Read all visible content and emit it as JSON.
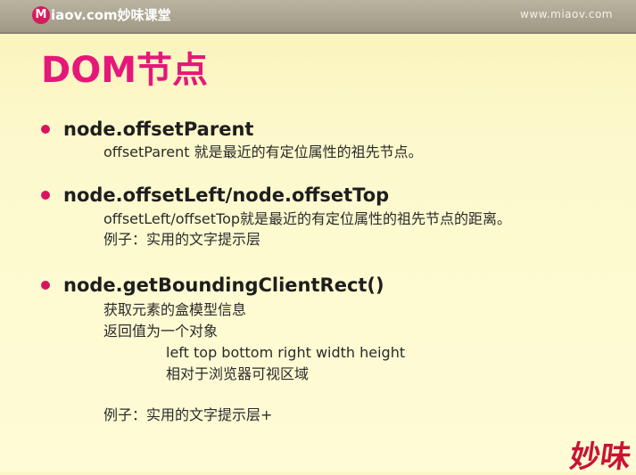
{
  "header": {
    "logo_mark": "M",
    "logo_text": "iaov.com妙味课堂",
    "site_url": "www.miaov.com"
  },
  "slide": {
    "title": "DOM节点",
    "items": [
      {
        "heading": "node.offsetParent",
        "lines": [
          "offsetParent 就是最近的有定位属性的祖先节点。"
        ]
      },
      {
        "heading": "node.offsetLeft/node.offsetTop",
        "lines": [
          "offsetLeft/offsetTop就是最近的有定位属性的祖先节点的距离。",
          "例子：实用的文字提示层"
        ]
      },
      {
        "heading": "node.getBoundingClientRect()",
        "lines": [
          "获取元素的盒模型信息",
          "返回值为一个对象",
          "left  top bottom right width height",
          "相对于浏览器可视区域",
          "例子：实用的文字提示层+"
        ]
      }
    ]
  },
  "watermark": {
    "text": "妙味"
  }
}
